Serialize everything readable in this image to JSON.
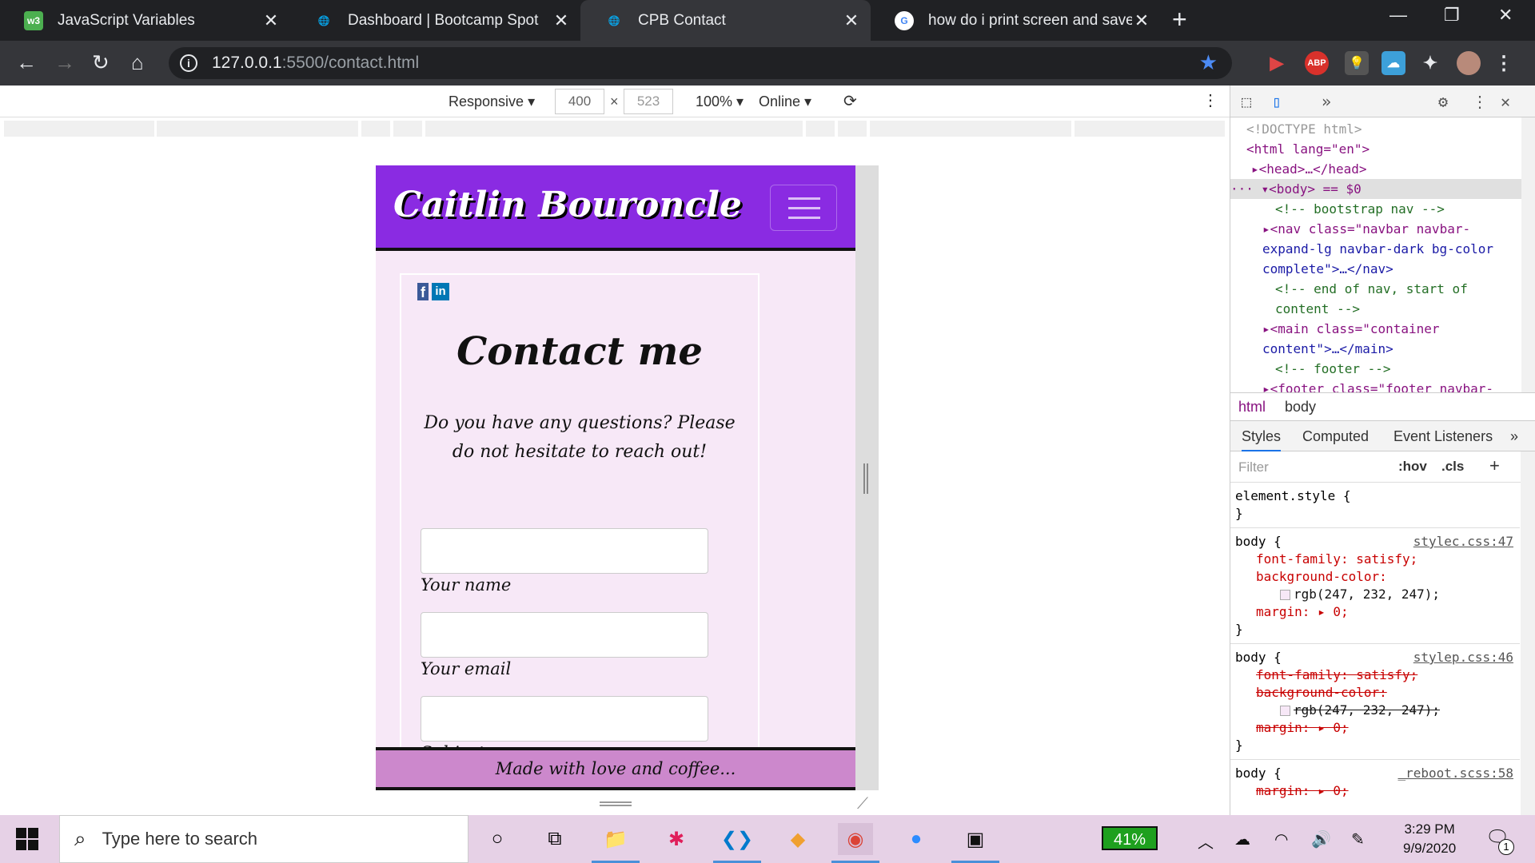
{
  "browser": {
    "tabs": [
      {
        "title": "JavaScript Variables",
        "icon": "w3-icon",
        "fav": "w3"
      },
      {
        "title": "Dashboard | Bootcamp Spot",
        "icon": "globe-icon",
        "fav": "🌐"
      },
      {
        "title": "CPB Contact",
        "icon": "globe-icon",
        "fav": "🌐"
      },
      {
        "title": "how do i print screen and save to",
        "icon": "google-icon",
        "fav": "G"
      }
    ],
    "url_host": "127.0.0.1",
    "url_rest": ":5500/contact.html"
  },
  "device_toolbar": {
    "mode": "Responsive",
    "width": "400",
    "height": "523",
    "zoom": "100%",
    "network": "Online",
    "times": "×"
  },
  "page": {
    "brand": "Caitlin Bouroncle",
    "heading": "Contact me",
    "lead": "Do you have any questions? Please do not hesitate to reach out!",
    "fields": [
      {
        "label": "Your name",
        "value": ""
      },
      {
        "label": "Your email",
        "value": ""
      },
      {
        "label": "Subject",
        "value": ""
      }
    ],
    "footer": "Made with love and coffee..."
  },
  "devtools": {
    "elements": [
      "<!DOCTYPE html>",
      "<html lang=\"en\">",
      "<head>…</head>",
      "<body> == $0",
      "<!-- bootstrap nav -->",
      "<nav class=\"navbar navbar-",
      "expand-lg navbar-dark bg-color",
      "complete\">…</nav>",
      "<!-- end of nav, start of",
      "content -->",
      "<main class=\"container",
      "content\">…</main>",
      "<!-- footer -->",
      "<footer class=\"footer navbar-"
    ],
    "breadcrumbs": [
      "html",
      "body"
    ],
    "style_tabs": [
      "Styles",
      "Computed",
      "Event Listeners",
      "»"
    ],
    "filter_placeholder": "Filter",
    "hov": ":hov",
    "cls": ".cls",
    "rules": [
      {
        "selector": "element.style {",
        "close": "}"
      },
      {
        "selector": "body {",
        "source": "stylec.css:47",
        "props": [
          "font-family: satisfy;",
          "background-color:",
          "rgb(247, 232, 247);",
          "margin: ▸ 0;"
        ],
        "close": "}"
      },
      {
        "selector": "body {",
        "source": "stylep.css:46",
        "props": [
          "font-family: satisfy;",
          "background-color:",
          "rgb(247, 232, 247);",
          "margin: ▸ 0;"
        ],
        "close": "}"
      },
      {
        "selector": "body {",
        "source": "_reboot.scss:58",
        "props": [
          "margin: ▸ 0;"
        ]
      }
    ]
  },
  "taskbar": {
    "search_placeholder": "Type here to search",
    "battery": "41%",
    "time": "3:29 PM",
    "date": "9/9/2020",
    "notifications": "1"
  }
}
